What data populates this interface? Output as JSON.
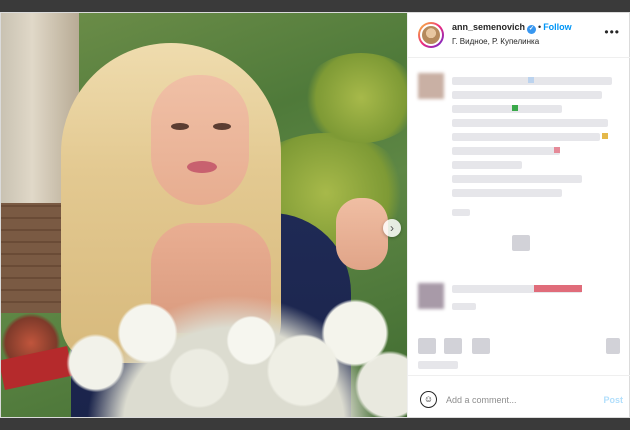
{
  "post": {
    "username": "ann_semenovich",
    "verified_badge": "✓",
    "separator": "•",
    "follow_label": "Follow",
    "location": "Г. Видное, Р. Купелинка",
    "more_label": "•••",
    "next_arrow": "›"
  },
  "comment_box": {
    "emoji_icon": "☺",
    "placeholder": "Add a comment...",
    "post_label": "Post"
  },
  "colors": {
    "link": "#0095f6",
    "post_disabled": "#b2dffc",
    "verified": "#3897f0"
  }
}
